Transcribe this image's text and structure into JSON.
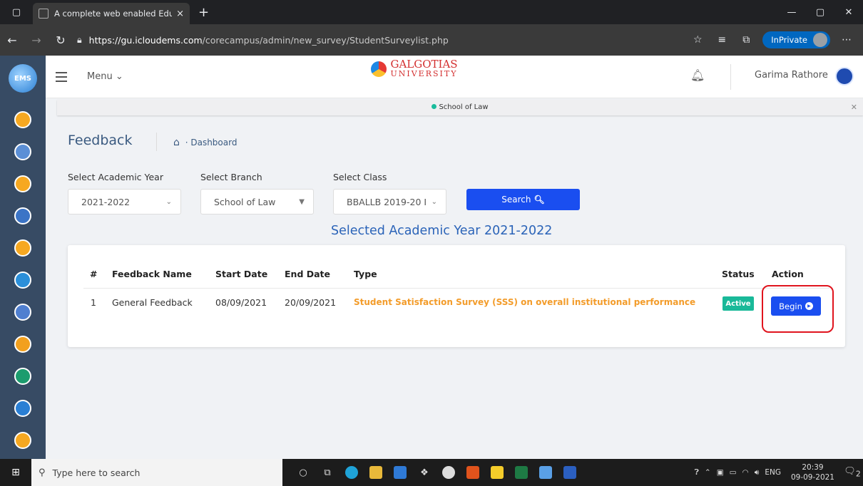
{
  "browser": {
    "tab_title": "A complete web enabled Educat",
    "tab_close": "×",
    "new_tab": "+",
    "url_host": "https://gu.icloudems.com",
    "url_path": "/corecampus/admin/new_survey/StudentSurveylist.php",
    "inprivate_label": "InPrivate"
  },
  "header": {
    "menu_label": "Menu",
    "brand_name": "GALGOTIAS",
    "brand_sub": "UNIVERSITY",
    "user_name": "Garima Rathore"
  },
  "school_bar": {
    "label": "School of Law"
  },
  "page": {
    "title": "Feedback",
    "breadcrumb": "Dashboard"
  },
  "filters": {
    "academic_year_label": "Select Academic Year",
    "academic_year_value": "2021-2022",
    "branch_label": "Select Branch",
    "branch_value": "School of Law",
    "class_label": "Select Class",
    "class_value": "BBALLB 2019-20 I",
    "search_label": "Search"
  },
  "selected_year_heading": "Selected Academic Year 2021-2022",
  "table": {
    "headers": {
      "num": "#",
      "name": "Feedback Name",
      "start": "Start Date",
      "end": "End Date",
      "type": "Type",
      "status": "Status",
      "action": "Action"
    },
    "rows": [
      {
        "num": "1",
        "name": "General Feedback",
        "start": "08/09/2021",
        "end": "20/09/2021",
        "type": "Student Satisfaction Survey (SSS) on overall institutional performance",
        "status": "Active",
        "action": "Begin"
      }
    ]
  },
  "taskbar": {
    "search_placeholder": "Type here to search",
    "language": "ENG",
    "time": "20:39",
    "date": "09-09-2021",
    "notification_count": "2"
  },
  "colors": {
    "primary_button": "#1a4ef0",
    "status_active": "#19b999",
    "type_text": "#f39c2a",
    "highlight": "#e0141e"
  }
}
